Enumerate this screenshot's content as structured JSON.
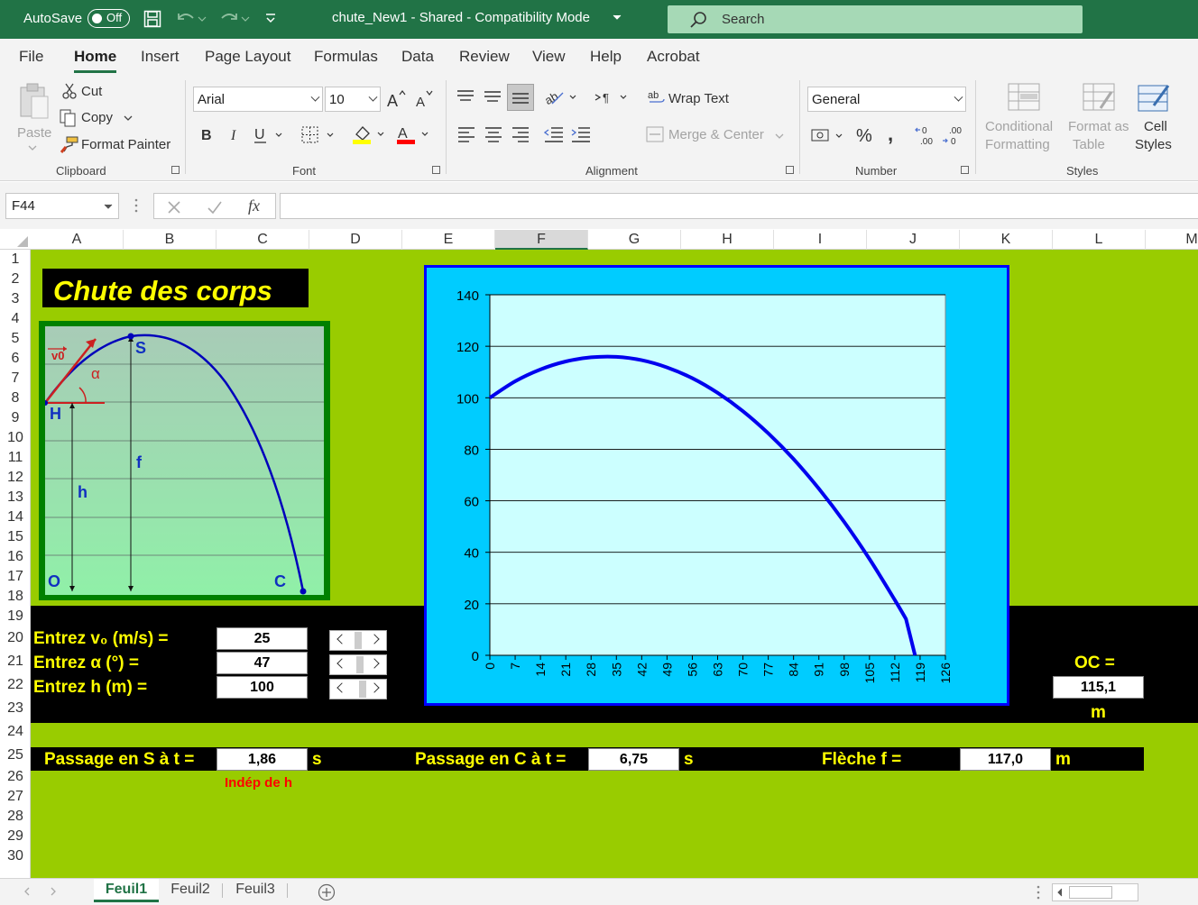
{
  "titlebar": {
    "autosave_label": "AutoSave",
    "toggle_state": "Off",
    "document_title": "chute_New1  -  Shared  -  Compatibility Mode",
    "search_placeholder": "Search"
  },
  "menu": {
    "tabs": [
      "File",
      "Home",
      "Insert",
      "Page Layout",
      "Formulas",
      "Data",
      "Review",
      "View",
      "Help",
      "Acrobat"
    ],
    "active": "Home"
  },
  "ribbon": {
    "clipboard": {
      "paste": "Paste",
      "cut": "Cut",
      "copy": "Copy",
      "format_painter": "Format Painter",
      "group": "Clipboard"
    },
    "font": {
      "name": "Arial",
      "size": "10",
      "group": "Font"
    },
    "alignment": {
      "wrap_text": "Wrap Text",
      "merge_center": "Merge & Center",
      "group": "Alignment"
    },
    "number": {
      "format": "General",
      "group": "Number"
    },
    "styles": {
      "conditional_1": "Conditional",
      "conditional_2": "Formatting",
      "format_as_1": "Format as",
      "format_as_2": "Table",
      "cell_styles_1": "Cell",
      "cell_styles_2": "Styles",
      "group": "Styles"
    },
    "colors": {
      "highlight": "#ffff00",
      "font_color": "#ff0000"
    }
  },
  "formula_bar": {
    "name_box": "F44",
    "fx": "fx",
    "formula": ""
  },
  "columns": [
    "A",
    "B",
    "C",
    "D",
    "E",
    "F",
    "G",
    "H",
    "I",
    "J",
    "K",
    "L",
    "M"
  ],
  "selected_column": "F",
  "rows": [
    "1",
    "2",
    "3",
    "4",
    "5",
    "6",
    "7",
    "8",
    "9",
    "10",
    "11",
    "12",
    "13",
    "14",
    "15",
    "16",
    "17",
    "18",
    "19",
    "20",
    "21",
    "22",
    "23",
    "24",
    "25",
    "26",
    "27",
    "28",
    "29",
    "30"
  ],
  "sheet": {
    "title": "Chute des corps",
    "inputs": {
      "v0_label": "Entrez v₀ (m/s) =",
      "v0_value": "25",
      "alpha_label": "Entrez α (°) =",
      "alpha_value": "47",
      "h_label": "Entrez h (m) =",
      "h_value": "100"
    },
    "oc_label": "OC =",
    "oc_value": "115,1",
    "oc_unit": "m",
    "passage_s_label": "Passage en S à t =",
    "passage_s_value": "1,86",
    "passage_s_unit": "s",
    "indep_note": "Indép de h",
    "passage_c_label": "Passage en C à t =",
    "passage_c_value": "6,75",
    "passage_c_unit": "s",
    "fleche_label": "Flèche f =",
    "fleche_value": "117,0",
    "fleche_unit": "m",
    "colors": {
      "background": "#99cc00",
      "label": "#ffff00",
      "band": "#000000",
      "note": "#ff0000"
    }
  },
  "diagram": {
    "labels": {
      "v0": "v0",
      "alpha": "α",
      "S": "S",
      "H": "H",
      "f": "f",
      "h": "h",
      "O": "O",
      "C": "C"
    }
  },
  "chart_data": {
    "type": "line",
    "x": [
      0,
      7,
      14,
      21,
      28,
      35,
      42,
      49,
      56,
      63,
      70,
      77,
      84,
      91,
      98,
      105,
      112,
      119,
      126
    ],
    "x_tick_labels": [
      "0",
      "7",
      "14",
      "21",
      "28",
      "35",
      "42",
      "49",
      "56",
      "63",
      "70",
      "77",
      "84",
      "91",
      "98",
      "105",
      "112",
      "119",
      "126"
    ],
    "y_ticks": [
      0,
      20,
      40,
      60,
      80,
      100,
      120,
      140
    ],
    "ylim": [
      0,
      140
    ],
    "xlim": [
      0,
      126
    ],
    "series": [
      {
        "color": "#0000ee",
        "x": [
          0,
          7,
          14,
          21,
          28,
          35,
          42,
          49,
          56,
          63,
          70,
          77,
          84,
          91,
          98,
          105,
          112,
          115.1
        ],
        "y": [
          100,
          106.4,
          111.0,
          114.1,
          115.7,
          115.9,
          114.6,
          111.8,
          107.6,
          101.9,
          94.8,
          86.2,
          76.2,
          64.7,
          51.8,
          37.4,
          21.5,
          14.1
        ]
      }
    ],
    "curve_end_x": 115.1,
    "grid": true,
    "colors": {
      "frame": "#00ccff",
      "frame_border": "#0000ff",
      "plot_bg": "#ccffff",
      "line": "#0000ee"
    }
  },
  "bottombar": {
    "tabs": [
      "Feuil1",
      "Feuil2",
      "Feuil3"
    ],
    "active": "Feuil1"
  }
}
